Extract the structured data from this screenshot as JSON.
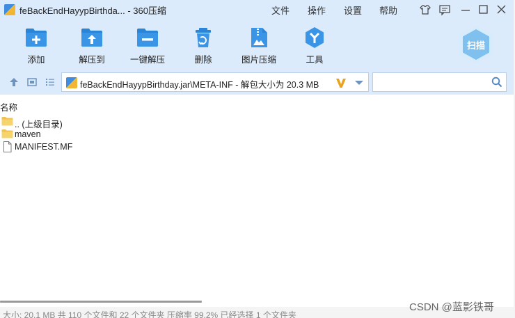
{
  "window": {
    "title": "feBackEndHayypBirthda... - 360压缩",
    "menu": [
      "文件",
      "操作",
      "设置",
      "帮助"
    ]
  },
  "toolbar": {
    "items": [
      {
        "label": "添加",
        "icon": "add-archive-icon"
      },
      {
        "label": "解压到",
        "icon": "extract-to-icon"
      },
      {
        "label": "一键解压",
        "icon": "one-click-extract-icon"
      },
      {
        "label": "删除",
        "icon": "delete-icon"
      },
      {
        "label": "图片压缩",
        "icon": "image-compress-icon"
      },
      {
        "label": "工具",
        "icon": "tools-icon"
      }
    ],
    "scan_label": "扫描"
  },
  "address": {
    "path": "feBackEndHayypBirthday.jar\\META-INF - 解包大小为 20.3 MB",
    "search_placeholder": ""
  },
  "list": {
    "column_name": "名称",
    "items": [
      {
        "name": ".. (上级目录)",
        "type": "folder"
      },
      {
        "name": "maven",
        "type": "folder"
      },
      {
        "name": "MANIFEST.MF",
        "type": "file"
      }
    ]
  },
  "status": {
    "text": "大小: 20.1 MB 共 110 个文件和 22 个文件夹 压缩率 99.2% 已经选择 1 个文件夹"
  },
  "watermark": "CSDN @蓝影铁哥",
  "colors": {
    "chrome_bg": "#dcebfb",
    "accent_blue": "#2a84d8",
    "folder_yellow": "#f2c14e"
  }
}
